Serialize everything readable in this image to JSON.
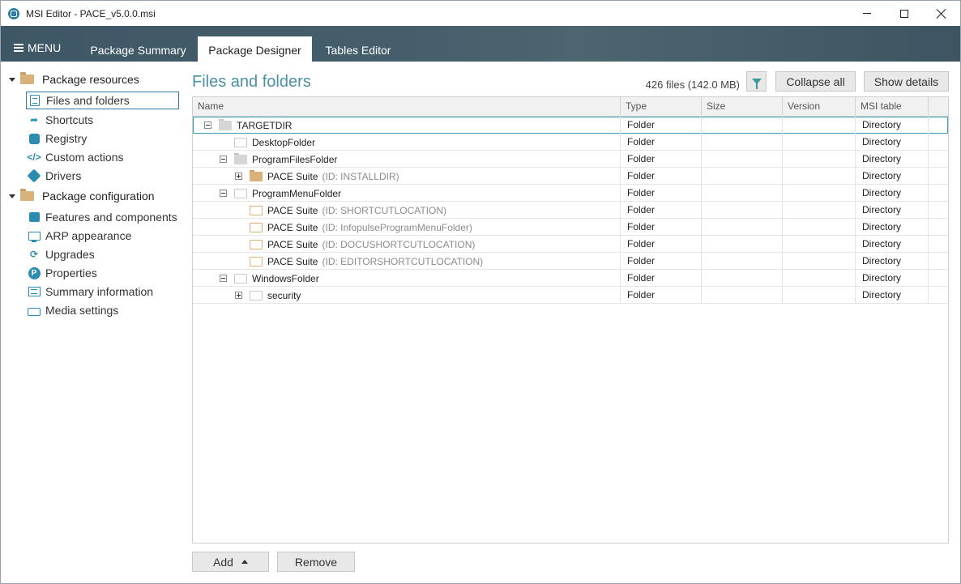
{
  "window": {
    "title": "MSI Editor - PACE_v5.0.0.msi"
  },
  "menu": {
    "label": "MENU"
  },
  "tabs": [
    {
      "label": "Package Summary"
    },
    {
      "label": "Package Designer"
    },
    {
      "label": "Tables Editor"
    }
  ],
  "sidebar": {
    "groups": [
      {
        "label": "Package resources",
        "items": [
          {
            "label": "Files and folders",
            "icon": "document-icon"
          },
          {
            "label": "Shortcuts",
            "icon": "shortcut-arrow-icon"
          },
          {
            "label": "Registry",
            "icon": "registry-cubes-icon"
          },
          {
            "label": "Custom actions",
            "icon": "code-brackets-icon"
          },
          {
            "label": "Drivers",
            "icon": "plug-icon"
          }
        ]
      },
      {
        "label": "Package configuration",
        "items": [
          {
            "label": "Features and components",
            "icon": "puzzle-icon"
          },
          {
            "label": "ARP appearance",
            "icon": "monitor-icon"
          },
          {
            "label": "Upgrades",
            "icon": "refresh-icon"
          },
          {
            "label": "Properties",
            "icon": "properties-p-icon"
          },
          {
            "label": "Summary information",
            "icon": "list-icon"
          },
          {
            "label": "Media settings",
            "icon": "drive-icon"
          }
        ]
      }
    ]
  },
  "main": {
    "title": "Files and folders",
    "file_count": "426 files (142.0 MB)",
    "collapse_all_label": "Collapse all",
    "show_details_label": "Show details",
    "add_label": "Add",
    "remove_label": "Remove"
  },
  "grid": {
    "columns": [
      "Name",
      "Type",
      "Size",
      "Version",
      "MSI table"
    ],
    "rows": [
      {
        "name": "TARGETDIR",
        "id": "",
        "type": "Folder",
        "size": "",
        "version": "",
        "table": "Directory"
      },
      {
        "name": "DesktopFolder",
        "id": "",
        "type": "Folder",
        "size": "",
        "version": "",
        "table": "Directory"
      },
      {
        "name": "ProgramFilesFolder",
        "id": "",
        "type": "Folder",
        "size": "",
        "version": "",
        "table": "Directory"
      },
      {
        "name": "PACE Suite",
        "id": "(ID: INSTALLDIR)",
        "type": "Folder",
        "size": "",
        "version": "",
        "table": "Directory"
      },
      {
        "name": "ProgramMenuFolder",
        "id": "",
        "type": "Folder",
        "size": "",
        "version": "",
        "table": "Directory"
      },
      {
        "name": "PACE Suite",
        "id": "(ID: SHORTCUTLOCATION)",
        "type": "Folder",
        "size": "",
        "version": "",
        "table": "Directory"
      },
      {
        "name": "PACE Suite",
        "id": "(ID: InfopulseProgramMenuFolder)",
        "type": "Folder",
        "size": "",
        "version": "",
        "table": "Directory"
      },
      {
        "name": "PACE Suite",
        "id": "(ID: DOCUSHORTCUTLOCATION)",
        "type": "Folder",
        "size": "",
        "version": "",
        "table": "Directory"
      },
      {
        "name": "PACE Suite",
        "id": "(ID: EDITORSHORTCUTLOCATION)",
        "type": "Folder",
        "size": "",
        "version": "",
        "table": "Directory"
      },
      {
        "name": "WindowsFolder",
        "id": "",
        "type": "Folder",
        "size": "",
        "version": "",
        "table": "Directory"
      },
      {
        "name": "security",
        "id": "",
        "type": "Folder",
        "size": "",
        "version": "",
        "table": "Directory"
      }
    ]
  }
}
